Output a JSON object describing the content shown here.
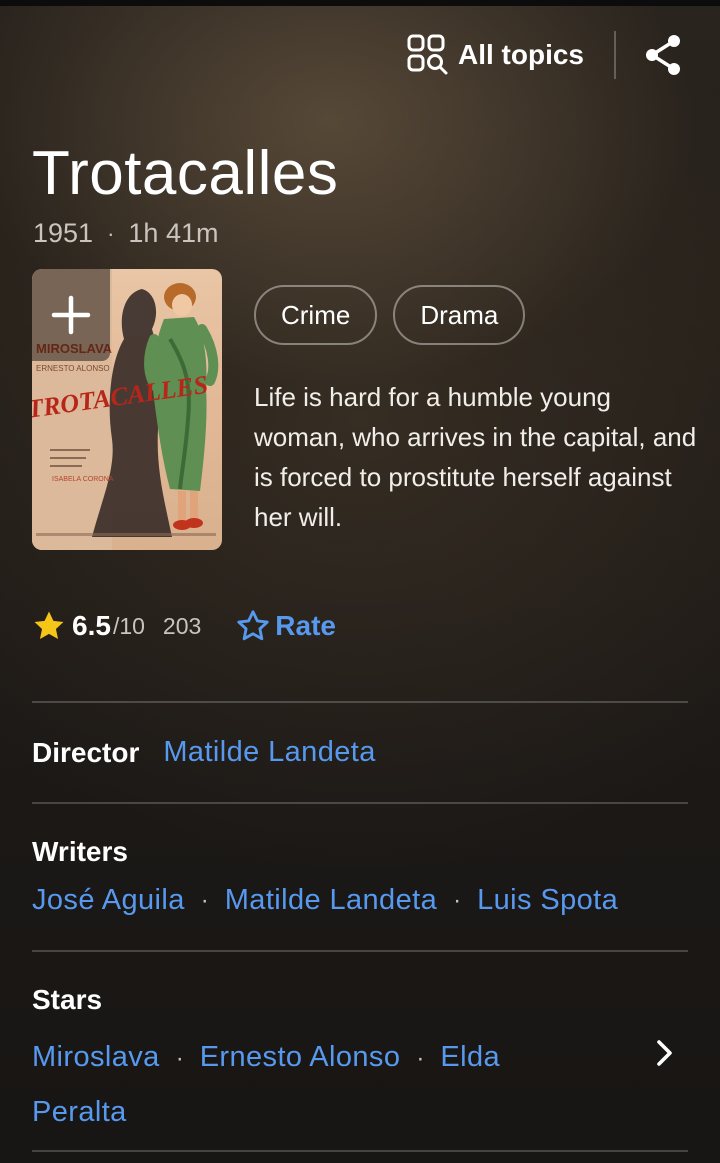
{
  "header": {
    "all_topics_label": "All topics",
    "icons": {
      "topics": "grid-search-icon",
      "share": "share-icon"
    }
  },
  "movie": {
    "title": "Trotacalles",
    "year": "1951",
    "separator": "·",
    "runtime": "1h 41m",
    "poster": {
      "add_icon": "plus-icon",
      "lettering": [
        "MIROSLAVA",
        "ERNESTO ALONSO",
        "TROTACALLES",
        "ISABELA CORONA"
      ]
    },
    "genres": [
      "Crime",
      "Drama"
    ],
    "plot": "Life is hard for a humble young woman, who arrives in the capital, and is forced to prostitute herself against her will."
  },
  "rating": {
    "score": "6.5",
    "out_of": "/10",
    "count": "203",
    "rate_label": "Rate",
    "star_color": "#f5c518",
    "link_color": "#5799ef"
  },
  "credits": {
    "director_label": "Director",
    "director": "Matilde Landeta",
    "writers_label": "Writers",
    "writers": [
      "José Aguila",
      "Matilde Landeta",
      "Luis Spota"
    ],
    "stars_label": "Stars",
    "stars": [
      "Miroslava",
      "Ernesto Alonso",
      "Elda Peralta"
    ],
    "separator": "·"
  }
}
